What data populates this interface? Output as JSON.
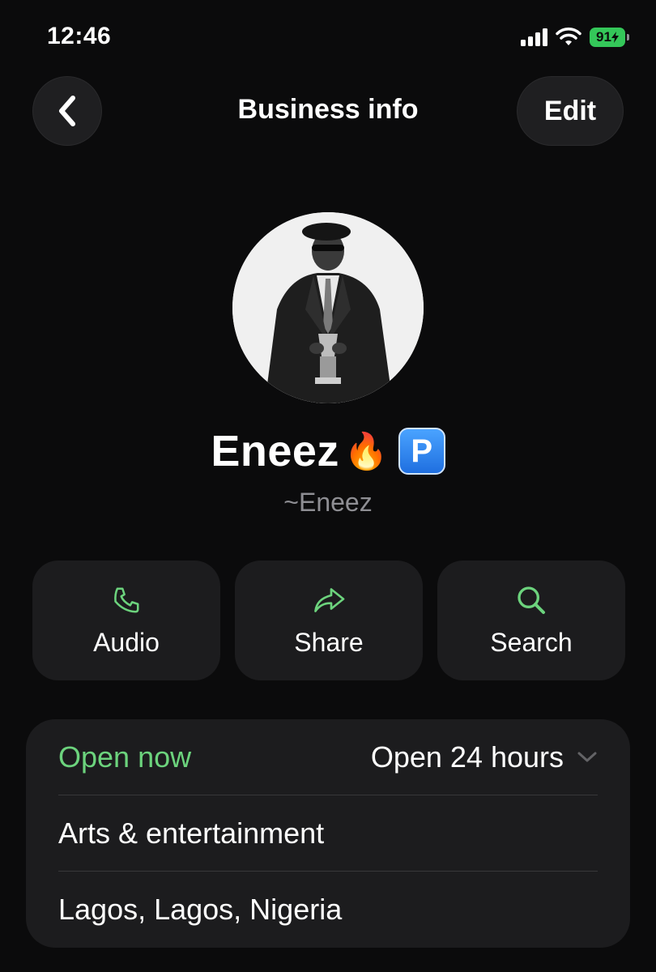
{
  "status_bar": {
    "time": "12:46",
    "battery": "91"
  },
  "nav": {
    "title": "Business info",
    "edit_label": "Edit"
  },
  "profile": {
    "name": "Eneez",
    "emoji": "🔥",
    "badge": "P",
    "subname": "~Eneez"
  },
  "actions": [
    {
      "label": "Audio",
      "icon": "phone-icon"
    },
    {
      "label": "Share",
      "icon": "share-arrow-icon"
    },
    {
      "label": "Search",
      "icon": "search-icon"
    }
  ],
  "info": {
    "open_status": "Open now",
    "hours": "Open 24 hours",
    "category": "Arts & entertainment",
    "location": "Lagos, Lagos, Nigeria"
  },
  "colors": {
    "accent_green": "#6cd37d",
    "battery_green": "#34c759",
    "card_bg": "#1c1c1e"
  }
}
